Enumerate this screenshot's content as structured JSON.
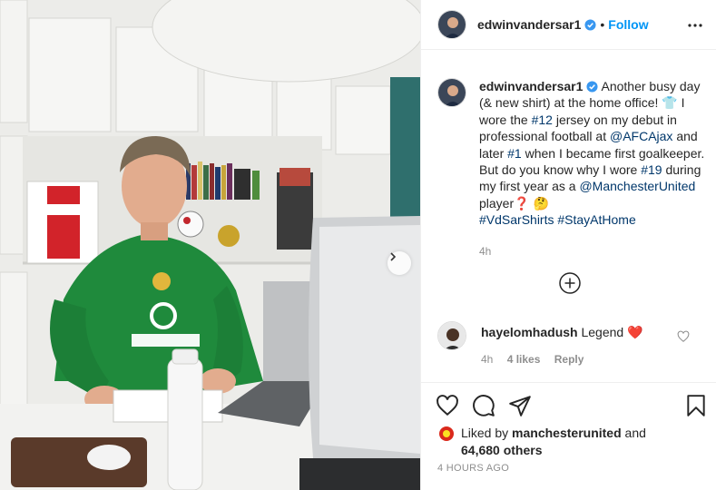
{
  "photo": {
    "description_alt": ""
  },
  "header": {
    "username": "edwinvandersar1",
    "dot": "•",
    "follow_label": "Follow"
  },
  "caption": {
    "username": "edwinvandersar1",
    "t1": " Another busy day (& new shirt) at the home office! ",
    "shirt_emoji": "👕",
    "t2": " I wore the ",
    "hash12": "#12",
    "t3": " jersey on my debut in professional football at ",
    "mention_ajax": "@AFCAjax",
    "t4": " and later ",
    "hash1": "#1",
    "t5": " when I became first goalkeeper. But do you know why I wore ",
    "hash19": "#19",
    "t6": " during my first year as a ",
    "mention_mu": "@ManchesterUnited",
    "t7": " player",
    "q_emoji": "❓",
    "think_emoji": "🤔",
    "hash_vdsar": "#VdSarShirts",
    "hash_home": "#StayAtHome",
    "time": "4h"
  },
  "comment": {
    "username": "hayelomhadush",
    "text": "Legend",
    "heart_emoji": "❤️",
    "time": "4h",
    "likes": "4 likes",
    "reply": "Reply"
  },
  "likes": {
    "prefix": "Liked by ",
    "user": "manchesterunited",
    "mid": " and",
    "count": "64,680 others"
  },
  "post_time": "4 HOURS AGO",
  "colors": {
    "link": "#00376b",
    "follow": "#0095f6",
    "muted": "#8e8e8e",
    "verified": "#3897f0"
  }
}
